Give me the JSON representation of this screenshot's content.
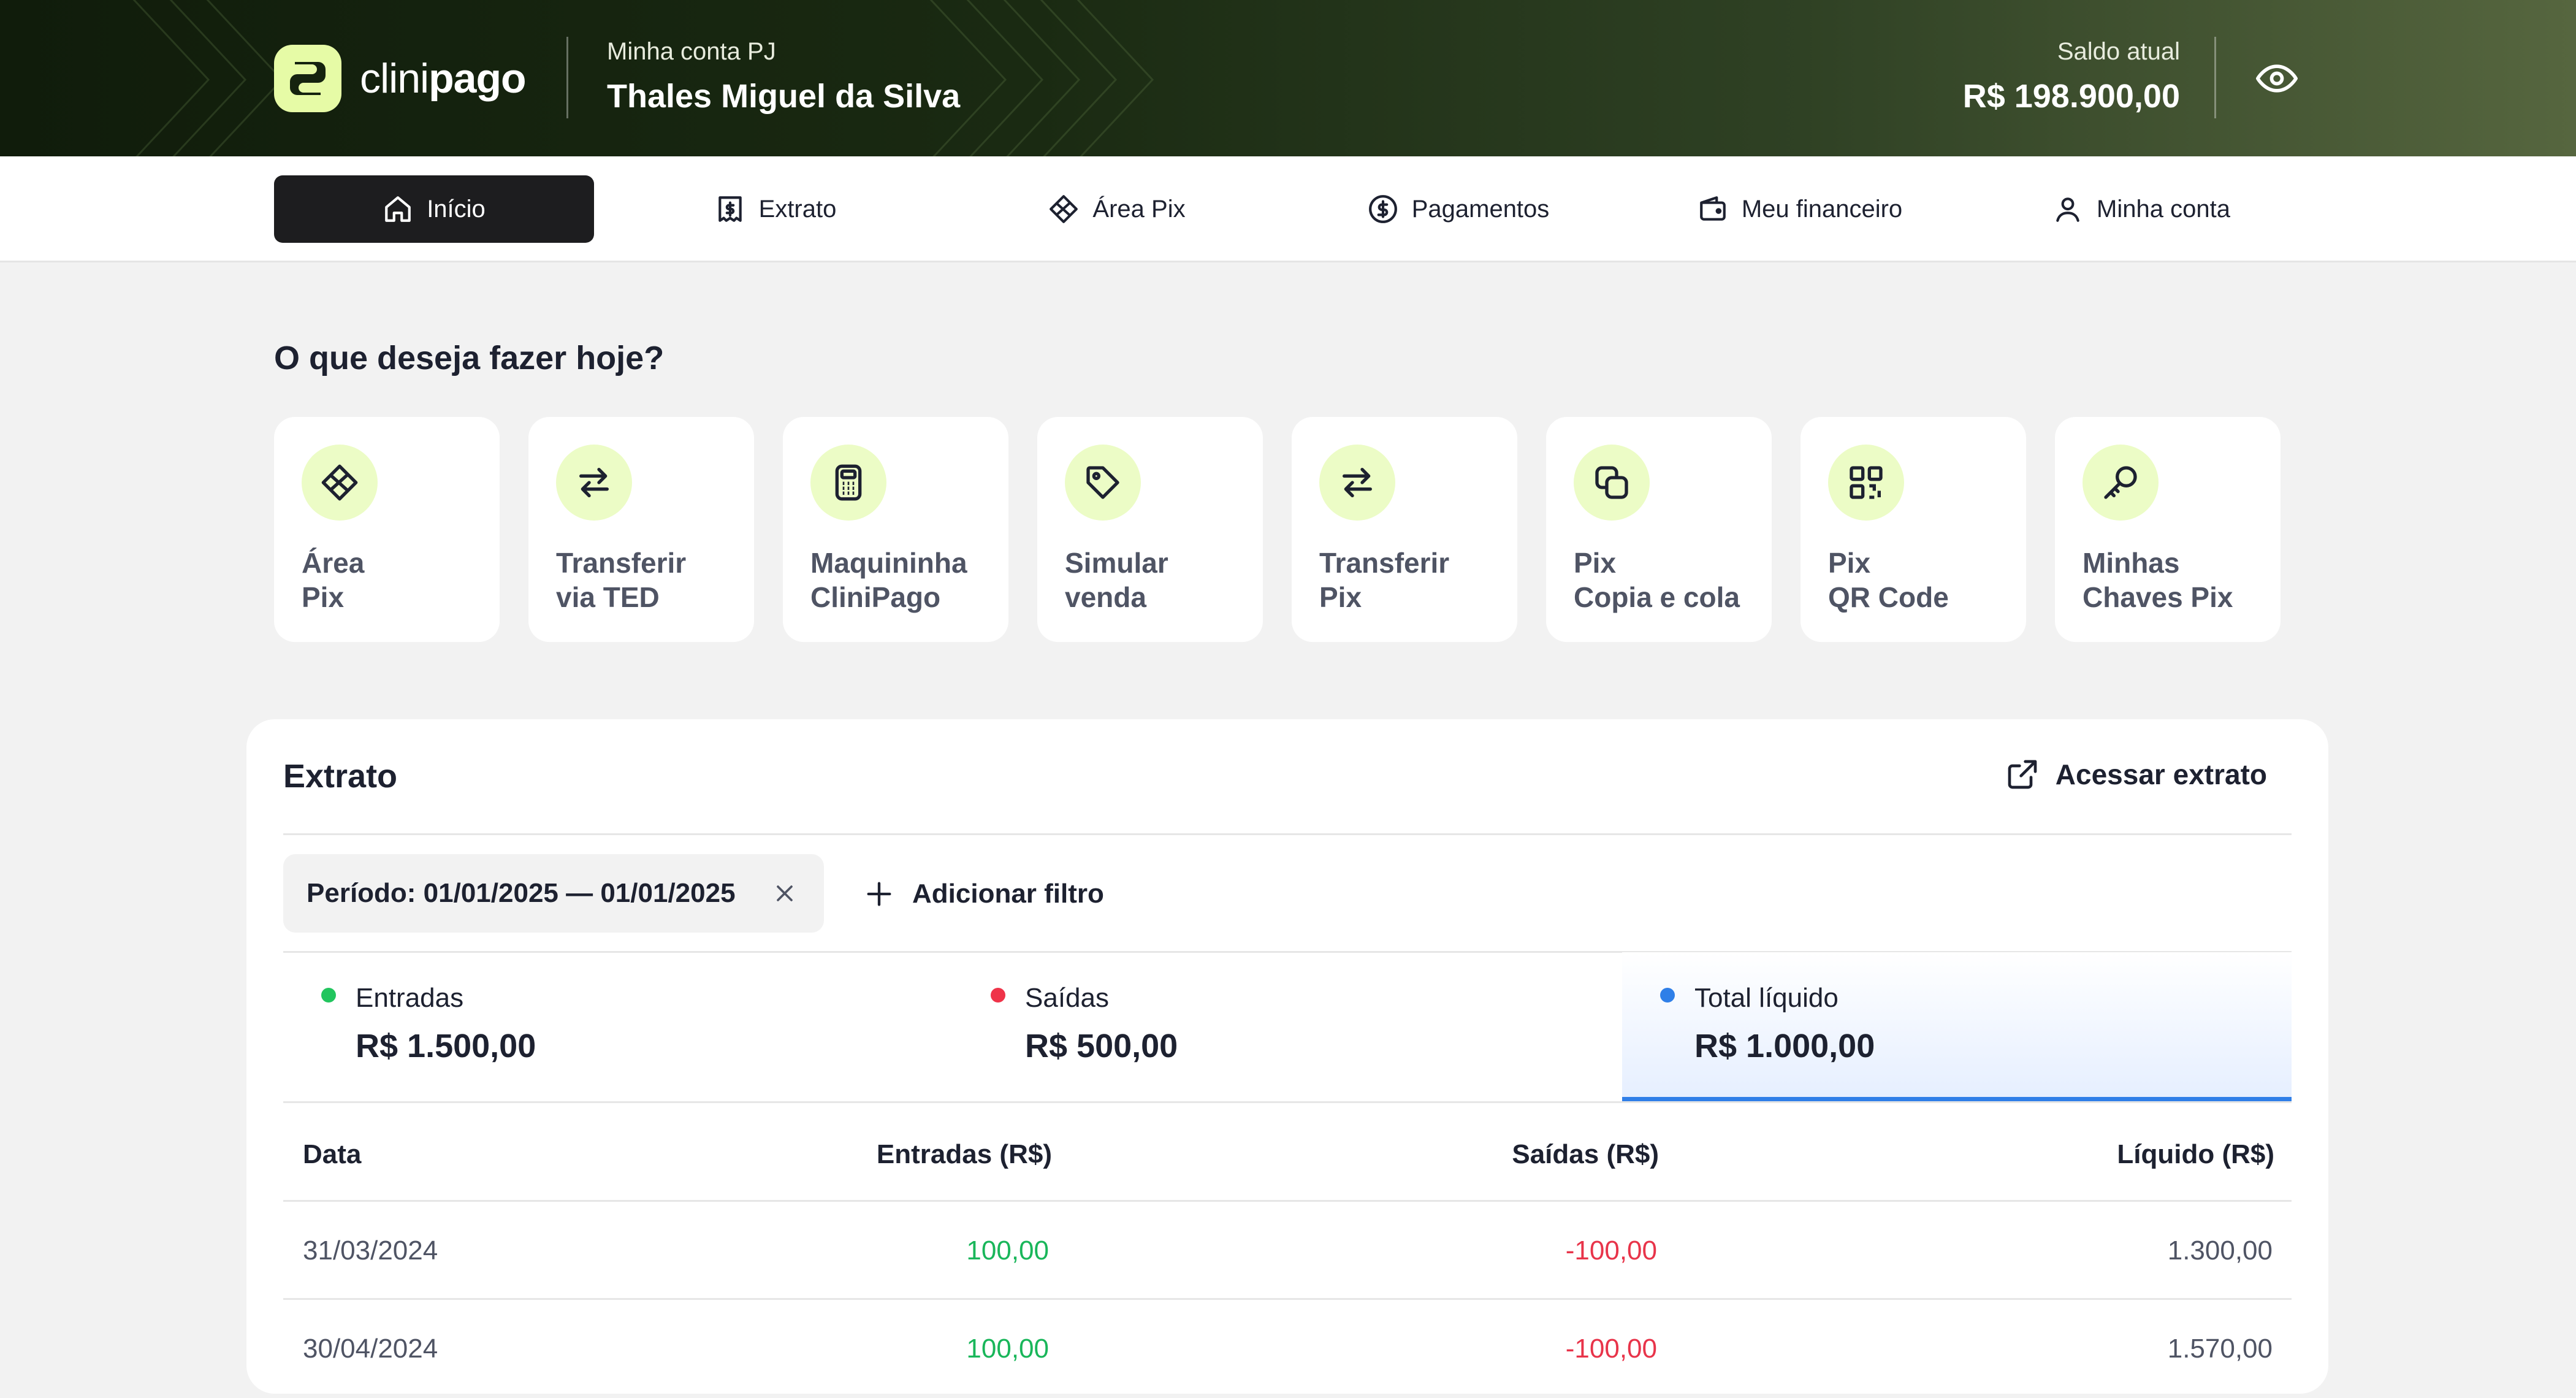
{
  "brand": {
    "logo_text_light": "clini",
    "logo_text_bold": "pago"
  },
  "header": {
    "account_type": "Minha conta PJ",
    "account_name": "Thales Miguel da Silva",
    "balance_label": "Saldo atual",
    "balance_value": "R$ 198.900,00",
    "visibility_icon": "eye-icon"
  },
  "nav": {
    "items": [
      {
        "label": "Início",
        "icon": "home-icon",
        "active": true
      },
      {
        "label": "Extrato",
        "icon": "receipt-icon",
        "active": false
      },
      {
        "label": "Área Pix",
        "icon": "pix-icon",
        "active": false
      },
      {
        "label": "Pagamentos",
        "icon": "dollar-circle-icon",
        "active": false
      },
      {
        "label": "Meu financeiro",
        "icon": "wallet-icon",
        "active": false
      },
      {
        "label": "Minha conta",
        "icon": "user-icon",
        "active": false
      }
    ]
  },
  "quick_actions": {
    "title": "O que deseja fazer hoje?",
    "items": [
      {
        "line1": "Área",
        "line2": "Pix",
        "icon": "pix-icon"
      },
      {
        "line1": "Transferir",
        "line2": "via TED",
        "icon": "arrows-swap-icon"
      },
      {
        "line1": "Maquininha",
        "line2": "CliniPago",
        "icon": "card-machine-icon"
      },
      {
        "line1": "Simular",
        "line2": "venda",
        "icon": "tag-icon"
      },
      {
        "line1": "Transferir",
        "line2": "Pix",
        "icon": "arrows-swap-icon"
      },
      {
        "line1": "Pix",
        "line2": "Copia e cola",
        "icon": "copy-icon"
      },
      {
        "line1": "Pix",
        "line2": "QR Code",
        "icon": "qr-code-icon"
      },
      {
        "line1": "Minhas",
        "line2": "Chaves Pix",
        "icon": "key-icon"
      }
    ]
  },
  "statement": {
    "title": "Extrato",
    "link_label": "Acessar extrato",
    "filter_chip": "Período: 01/01/2025 — 01/01/2025",
    "add_filter_label": "Adicionar filtro",
    "summary": [
      {
        "label": "Entradas",
        "value": "R$ 1.500,00",
        "color": "#22c55e"
      },
      {
        "label": "Saídas",
        "value": "R$ 500,00",
        "color": "#ef3349"
      },
      {
        "label": "Total líquido",
        "value": "R$ 1.000,00",
        "color": "#2f7fe8",
        "active": true
      }
    ],
    "columns": [
      "Data",
      "Entradas (R$)",
      "Saídas (R$)",
      "Líquido (R$)"
    ],
    "rows": [
      {
        "date": "31/03/2024",
        "in": "100,00",
        "out": "-100,00",
        "net": "1.300,00"
      },
      {
        "date": "30/04/2024",
        "in": "100,00",
        "out": "-100,00",
        "net": "1.570,00"
      }
    ]
  },
  "colors": {
    "accent_lime": "#e6fba6",
    "icon_bg": "#ecfcc6",
    "nav_active": "#1d1d1f",
    "positive": "#19b65a",
    "negative": "#e8344a",
    "highlight_blue": "#2f7fe8"
  }
}
